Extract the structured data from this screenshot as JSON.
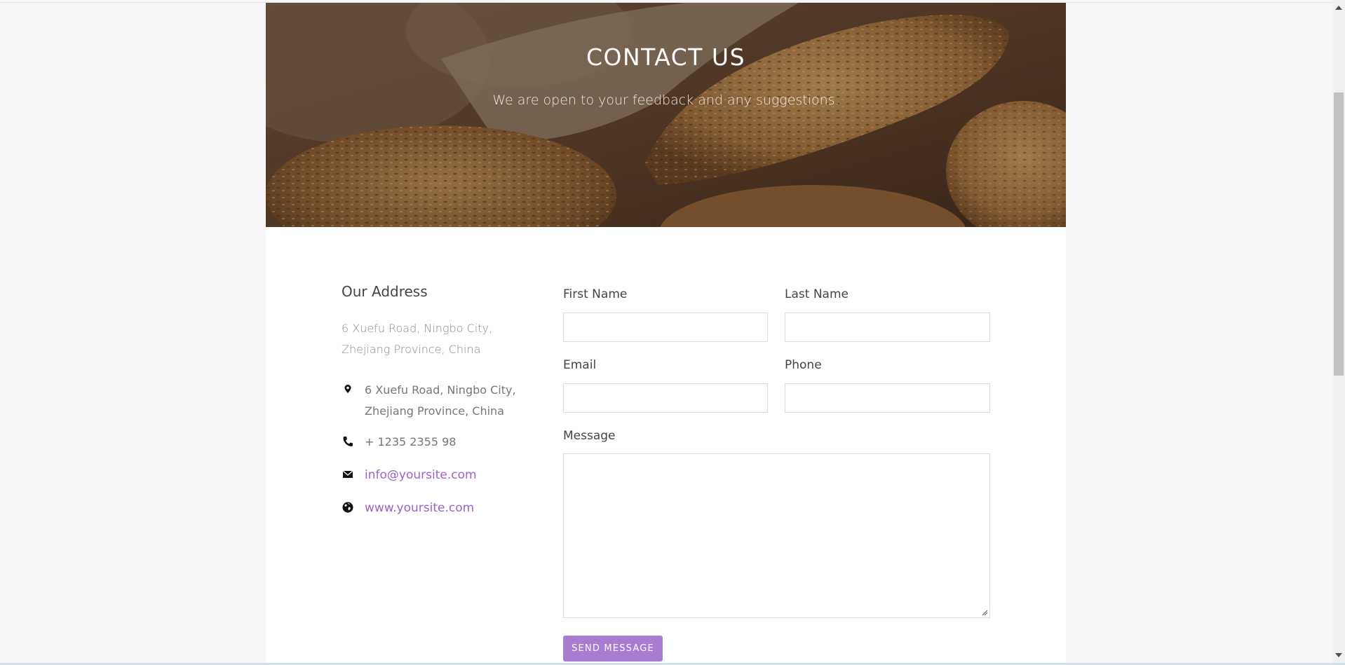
{
  "hero": {
    "title": "CONTACT US",
    "subtitle": "We are open to your feedback and any suggestions."
  },
  "address": {
    "heading": "Our Address",
    "text": "6 Xuefu Road, Ningbo City, Zhejiang Province, China",
    "items": [
      {
        "icon": "map-pin-icon",
        "text": "6 Xuefu Road, Ningbo City, Zhejiang Province, China"
      },
      {
        "icon": "phone-icon",
        "text": "+ 1235 2355 98"
      },
      {
        "icon": "mail-icon",
        "text": "info@yoursite.com"
      },
      {
        "icon": "globe-icon",
        "text": "www.yoursite.com"
      }
    ]
  },
  "form": {
    "first_name_label": "First Name",
    "last_name_label": "Last Name",
    "email_label": "Email",
    "phone_label": "Phone",
    "message_label": "Message",
    "first_name_value": "",
    "last_name_value": "",
    "email_value": "",
    "phone_value": "",
    "message_value": "",
    "submit_label": "SEND MESSAGE"
  },
  "colors": {
    "accent": "#a77cd1",
    "link": "#9b63c9",
    "page_bg": "#f7f5f7"
  }
}
